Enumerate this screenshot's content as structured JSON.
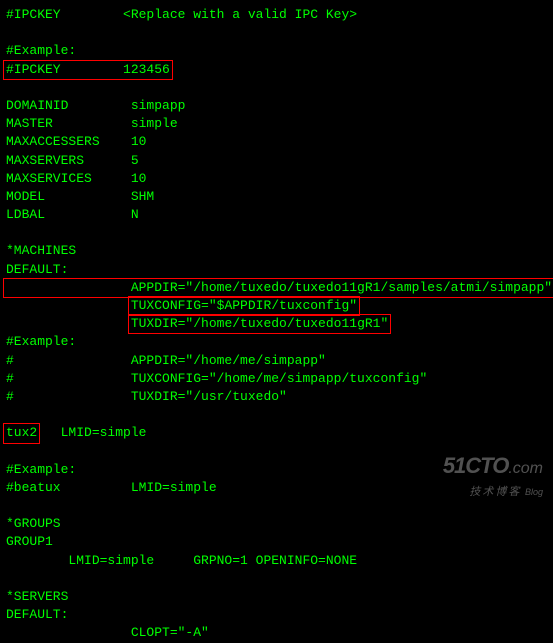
{
  "line_ipckey_comment": "#IPCKEY        <Replace with a valid IPC Key>",
  "line_blank": "",
  "line_example_hdr": "#Example:",
  "line_ipckey": "#IPCKEY        123456",
  "line_domainid": "DOMAINID        simpapp",
  "line_master": "MASTER          simple",
  "line_maxaccessers": "MAXACCESSERS    10",
  "line_maxservers": "MAXSERVERS      5",
  "line_maxservices": "MAXSERVICES     10",
  "line_model": "MODEL           SHM",
  "line_ldbal": "LDBAL           N",
  "line_machines": "*MACHINES",
  "line_default": "DEFAULT:",
  "line_appdir": "                APPDIR=\"/home/tuxedo/tuxedo11gR1/samples/atmi/simpapp\"",
  "line_tuxconfig_pad": "                ",
  "line_tuxconfig": "TUXCONFIG=\"$APPDIR/tuxconfig\"",
  "line_tuxdir_pad": "                ",
  "line_tuxdir": "TUXDIR=\"/home/tuxedo/tuxedo11gR1\"",
  "line_ex_appdir": "#               APPDIR=\"/home/me/simpapp\"",
  "line_ex_tuxconfig": "#               TUXCONFIG=\"/home/me/simpapp/tuxconfig\"",
  "line_ex_tuxdir": "#               TUXDIR=\"/usr/tuxedo\"",
  "line_tux2_host": "tux2",
  "line_tux2_lmid": "   LMID=simple",
  "line_beatux": "#beatux         LMID=simple",
  "line_groups": "*GROUPS",
  "line_group1": "GROUP1",
  "line_group1_body": "        LMID=simple     GRPNO=1 OPENINFO=NONE",
  "line_servers": "*SERVERS",
  "line_default2": "DEFAULT:",
  "line_clopt": "                CLOPT=\"-A\"",
  "watermark": {
    "main": "51CTO",
    "com": ".com",
    "sub": "技术博客",
    "blog": "Blog"
  }
}
